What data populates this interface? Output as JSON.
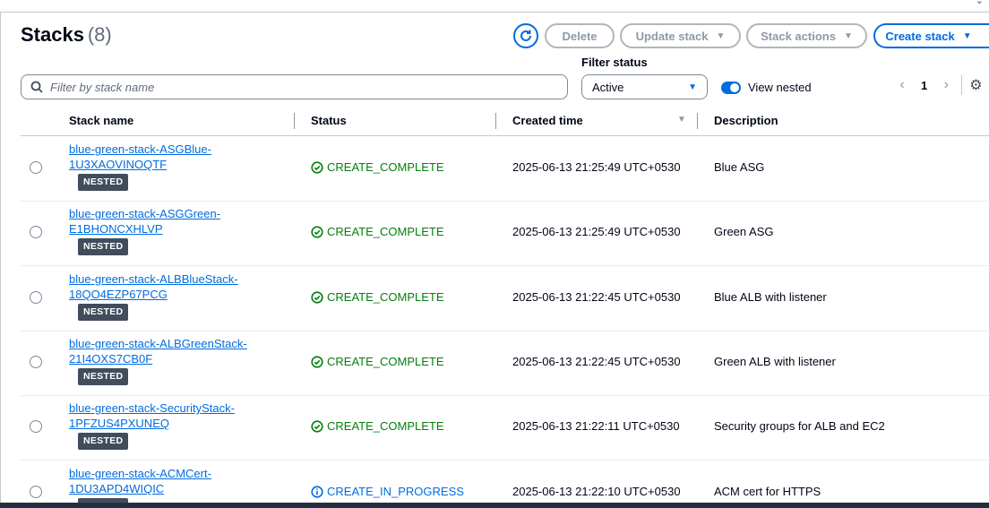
{
  "header": {
    "title": "Stacks",
    "count": "(8)"
  },
  "toolbar": {
    "delete_label": "Delete",
    "update_label": "Update stack",
    "actions_label": "Stack actions",
    "create_label": "Create stack"
  },
  "filter": {
    "search_placeholder": "Filter by stack name",
    "status_label": "Filter status",
    "status_value": "Active",
    "view_nested_label": "View nested",
    "view_nested_on": true
  },
  "pagination": {
    "current_page": "1"
  },
  "table": {
    "columns": [
      "Stack name",
      "Status",
      "Created time",
      "Description"
    ],
    "rows": [
      {
        "name_line1": "blue-green-stack-ASGBlue-",
        "name_line2": "1U3XAOVINOQTF",
        "badge": "NESTED",
        "status": "CREATE_COMPLETE",
        "status_kind": "complete",
        "created": "2025-06-13 21:25:49 UTC+0530",
        "description": "Blue ASG"
      },
      {
        "name_line1": "blue-green-stack-ASGGreen-",
        "name_line2": "E1BHONCXHLVP",
        "badge": "NESTED",
        "status": "CREATE_COMPLETE",
        "status_kind": "complete",
        "created": "2025-06-13 21:25:49 UTC+0530",
        "description": "Green ASG"
      },
      {
        "name_line1": "blue-green-stack-ALBBlueStack-",
        "name_line2": "18QO4EZP67PCG",
        "badge": "NESTED",
        "status": "CREATE_COMPLETE",
        "status_kind": "complete",
        "created": "2025-06-13 21:22:45 UTC+0530",
        "description": "Blue ALB with listener"
      },
      {
        "name_line1": "blue-green-stack-ALBGreenStack-",
        "name_line2": "21I4OXS7CB0F",
        "badge": "NESTED",
        "status": "CREATE_COMPLETE",
        "status_kind": "complete",
        "created": "2025-06-13 21:22:45 UTC+0530",
        "description": "Green ALB with listener"
      },
      {
        "name_line1": "blue-green-stack-SecurityStack-",
        "name_line2": "1PFZUS4PXUNEQ",
        "badge": "NESTED",
        "status": "CREATE_COMPLETE",
        "status_kind": "complete",
        "created": "2025-06-13 21:22:11 UTC+0530",
        "description": "Security groups for ALB and EC2"
      },
      {
        "name_line1": "blue-green-stack-ACMCert-",
        "name_line2": "1DU3APD4WIQIC",
        "badge": "NESTED",
        "status": "CREATE_IN_PROGRESS",
        "status_kind": "in-progress",
        "created": "2025-06-13 21:22:10 UTC+0530",
        "description": "ACM cert for HTTPS"
      }
    ]
  },
  "colors": {
    "accent": "#006ce0",
    "success": "#037f0c",
    "badge_bg": "#414d5c",
    "disabled": "#8d99a8"
  }
}
